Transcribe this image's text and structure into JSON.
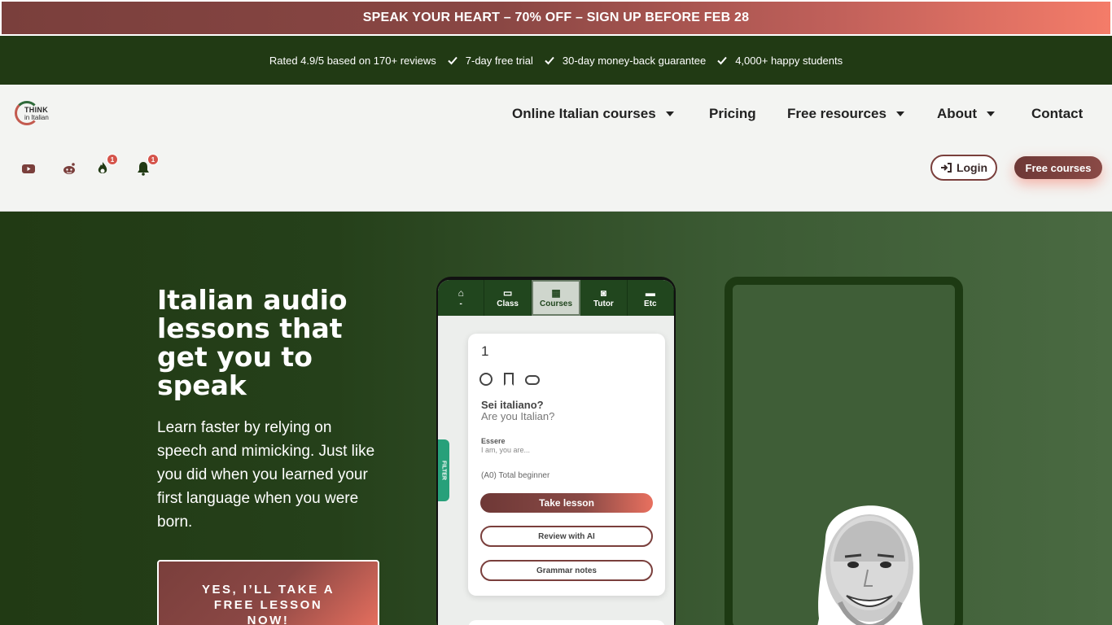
{
  "promo": {
    "text": "SPEAK YOUR HEART – 70% OFF – SIGN UP BEFORE FEB 28"
  },
  "trust": {
    "rating": "Rated 4.9/5 based on 170+ reviews",
    "items": [
      "7-day free trial",
      "30-day money-back guarantee",
      "4,000+ happy students"
    ]
  },
  "logo": {
    "line1": "THINK",
    "line2": "in Italian"
  },
  "nav": {
    "items": [
      {
        "label": "Online Italian courses",
        "dropdown": true
      },
      {
        "label": "Pricing",
        "dropdown": false
      },
      {
        "label": "Free resources",
        "dropdown": true
      },
      {
        "label": "About",
        "dropdown": true
      },
      {
        "label": "Contact",
        "dropdown": false
      }
    ]
  },
  "social": {
    "icons": [
      "youtube-icon",
      "reddit-icon",
      "flame-icon",
      "bell-icon"
    ],
    "flame_badge": "1",
    "bell_badge": "1"
  },
  "header_buttons": {
    "login": "Login",
    "free_courses": "Free courses"
  },
  "hero": {
    "title": "Italian audio lessons that get you to speak",
    "subtitle": "Learn faster by relying on speech and mimicking. Just like you did when you learned your first language when you were born.",
    "cta": "YES, I’LL TAKE A FREE LESSON NOW!"
  },
  "app": {
    "tabs": [
      {
        "label": "-",
        "icon": "home-icon"
      },
      {
        "label": "Class",
        "icon": "class-icon"
      },
      {
        "label": "Courses",
        "icon": "grid-icon",
        "active": true
      },
      {
        "label": "Tutor",
        "icon": "robot-icon"
      },
      {
        "label": "Etc",
        "icon": "folder-icon"
      }
    ],
    "card": {
      "number": "1",
      "italian": "Sei italiano?",
      "english": "Are you Italian?",
      "verb": "Essere",
      "verb_en": "I am, you are...",
      "level": "(A0) Total beginner",
      "take_lesson": "Take lesson",
      "review": "Review with AI",
      "grammar": "Grammar notes"
    },
    "filter": "FILTER"
  },
  "colors": {
    "dark_green": "#213a14",
    "brand_maroon": "#7a3f3c",
    "brand_coral": "#f47c69"
  }
}
